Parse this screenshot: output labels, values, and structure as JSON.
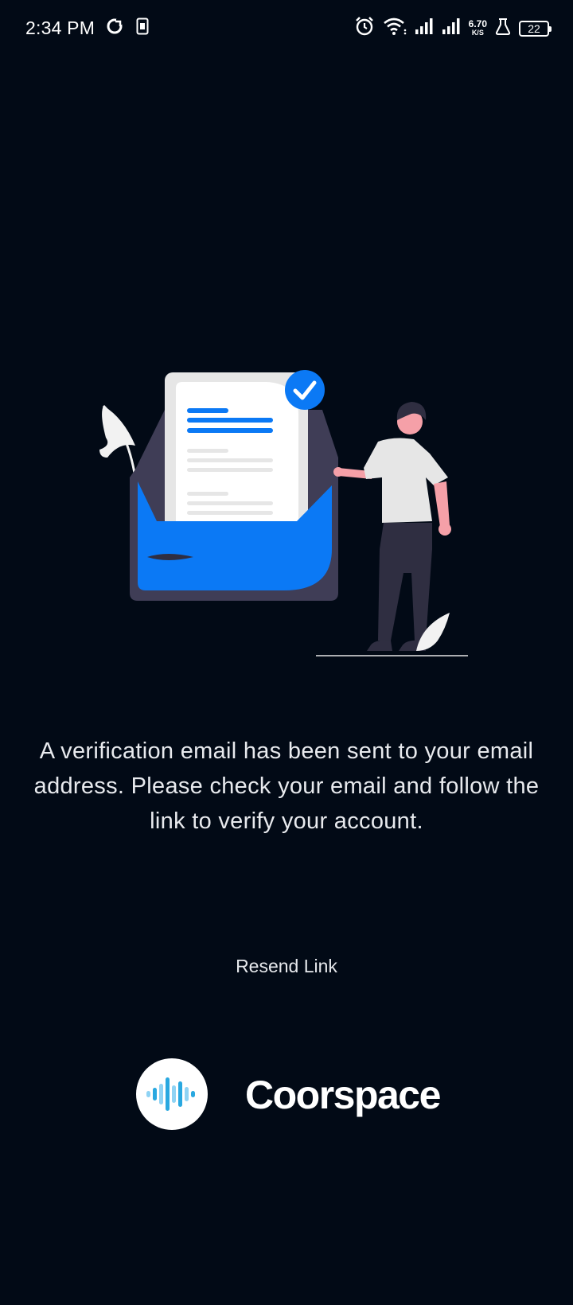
{
  "status_bar": {
    "time": "2:34 PM",
    "net_speed_value": "6.70",
    "net_speed_unit": "K/S",
    "battery_level": "22",
    "icons": [
      "sync-icon",
      "sim-card-icon",
      "alarm-icon",
      "wifi-icon",
      "signal-icon",
      "signal-icon",
      "lab-flask-icon",
      "battery-icon"
    ]
  },
  "illustration": {
    "icon": "email-verified-illustration",
    "colors": {
      "envelope_dark": "#3f3d56",
      "envelope_blue": "#0b79f5",
      "paper": "#e6e6e6",
      "check_badge": "#0b79f5",
      "skin": "#f5a0a8",
      "shirt": "#e6e6e6",
      "pants": "#2f2e41"
    }
  },
  "message": {
    "text": "A verification email has been sent to your email address. Please check your email and follow the link to verify your account."
  },
  "actions": {
    "resend_label": "Resend Link"
  },
  "brand": {
    "name": "Coorspace",
    "logo_icon": "soundwave-logo-icon",
    "accent_color": "#29a8e0"
  }
}
